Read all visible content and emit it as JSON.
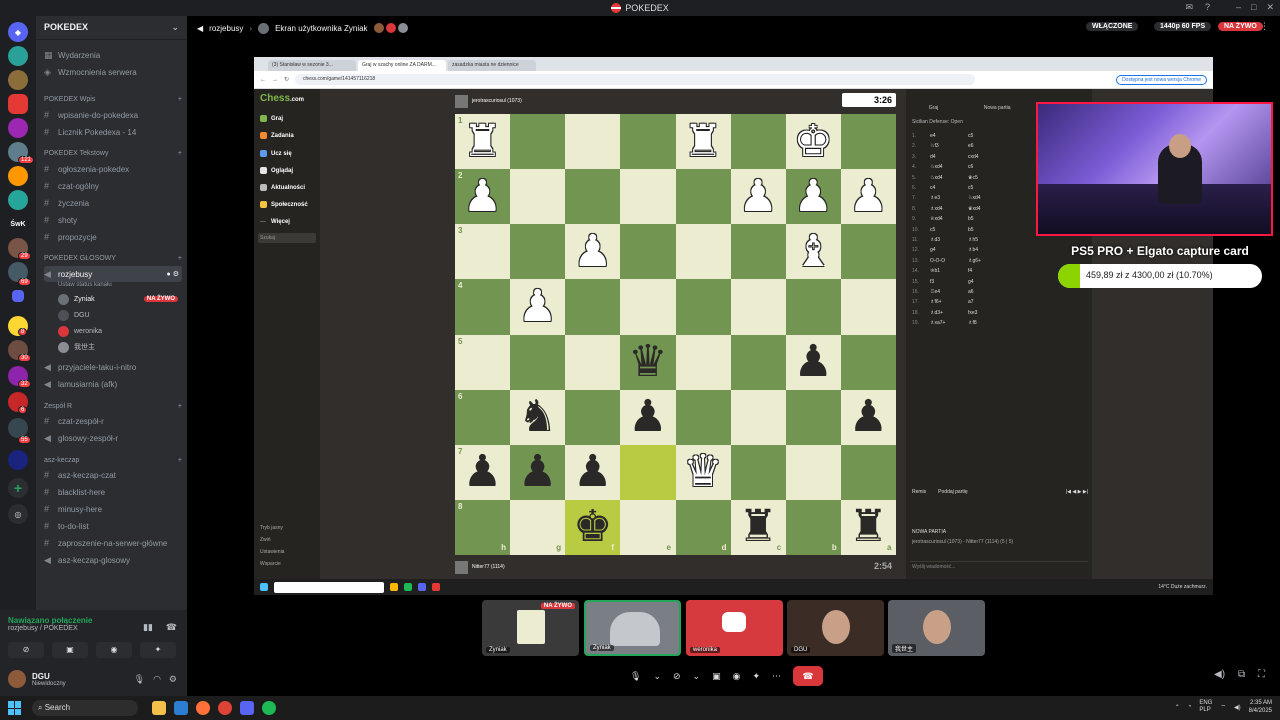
{
  "window": {
    "title": "POKEDEX"
  },
  "sidebar": {
    "server_name": "POKEDEX",
    "top_items": [
      "Wydarzenia",
      "Wzmocnienia serwera"
    ],
    "categories": [
      {
        "name": "POKEDEX Wpis",
        "channels": [
          "wpisanie-do-pokedexa",
          "Licznik Pokedexa - 14"
        ]
      },
      {
        "name": "POKEDEX Tekstowy",
        "channels": [
          "ogłoszenia-pokedex",
          "czat-ogólny",
          "życzenia",
          "shoty",
          "propozycje"
        ]
      },
      {
        "name": "POKEDEX GŁOSOWY",
        "channels": [
          "rozjebusy"
        ]
      },
      {
        "name": "Zespół R",
        "channels": [
          "czat-zespół-r",
          "glosowy-zespół-r"
        ]
      },
      {
        "name": "asz-keczap",
        "channels": [
          "asz-keczap-czat",
          "blacklist-here",
          "minusy-here",
          "to-do-list",
          "zaproszenie-na-serwer-główne",
          "asz-keczap-glosowy"
        ]
      }
    ],
    "voice_status_set": "Ustaw status kanału",
    "voice_users": [
      {
        "name": "Zyniak",
        "live": "NA ŻYWO"
      },
      {
        "name": "DGU",
        "live": ""
      },
      {
        "name": "weronika",
        "live": ""
      },
      {
        "name": "我世主",
        "live": ""
      }
    ],
    "other_channels": [
      "przyjaciele-taku-i-nitro",
      "lamusiarnia (afk)"
    ],
    "server_badges": [
      "29",
      "69",
      "121",
      "8",
      "30",
      "32",
      "6",
      "55"
    ]
  },
  "voice_panel": {
    "status": "Nawiązano połączenie",
    "subtitle": "rozjebusy / POKEDEX"
  },
  "user_panel": {
    "name": "DGU",
    "status": "Niewidoczny"
  },
  "header": {
    "channel": "rozjebusy",
    "stream_label": "Ekran użytkownika Zyniak",
    "enabled": "WŁĄCZONE",
    "quality": "1440p 60 FPS",
    "live": "NA ŻYWO"
  },
  "browser": {
    "url": "chess.com/game/141457116218",
    "update_btn": "Dostępna jest nowa wersja Chrome",
    "tabs": [
      "(3) Stanisław w sezonie 3...",
      "Graj w szachy online ZA DARM...",
      "zasadzka miasta ne dziennice"
    ]
  },
  "chess": {
    "logo_main": "Chess",
    "logo_suffix": ".com",
    "nav": [
      "Graj",
      "Zadania",
      "Ucz się",
      "Oglądaj",
      "Aktualności",
      "Społeczność",
      "Więcej"
    ],
    "search_placeholder": "Szukaj",
    "footer": [
      "Tryb jasny",
      "Zwiń",
      "Ustawienia",
      "Wsparcie"
    ],
    "opponent": "jerotrascuriosul (1073)",
    "player": "Nitter77 (1114)",
    "opp_clock": "3:26",
    "my_clock": "2:54",
    "ranks": [
      "1",
      "2",
      "3",
      "4",
      "5",
      "6",
      "7",
      "8"
    ],
    "files": [
      "h",
      "g",
      "f",
      "e",
      "d",
      "c",
      "b",
      "a"
    ],
    "panel_tabs": [
      "Graj",
      "Nowa partia",
      "Partie"
    ],
    "opening": "Sicilian Defense: Open",
    "moves": [
      [
        "1.",
        "e4",
        "c5"
      ],
      [
        "2.",
        "♘f3",
        "e6"
      ],
      [
        "3.",
        "d4",
        "cxd4"
      ],
      [
        "4.",
        "♘xd4",
        "c6"
      ],
      [
        "5.",
        "♘xd4",
        "♛c5"
      ],
      [
        "6.",
        "c4",
        "c5"
      ],
      [
        "7.",
        "♗e3",
        "♘xd4"
      ],
      [
        "8.",
        "♗xd4",
        "♛xd4"
      ],
      [
        "9.",
        "♕xd4",
        "b5"
      ],
      [
        "10.",
        "c5",
        "b5"
      ],
      [
        "11.",
        "♗d3",
        "♗h5"
      ],
      [
        "12.",
        "g4",
        "♗b4"
      ],
      [
        "13.",
        "O-O-O",
        "♗g6+"
      ],
      [
        "14.",
        "♔b1",
        "f4"
      ],
      [
        "15.",
        "f3",
        "g4"
      ],
      [
        "16.",
        "♖e4",
        "a6"
      ],
      [
        "17.",
        "♗f6+",
        "a7"
      ],
      [
        "18.",
        "♗d3+",
        "fxe3"
      ],
      [
        "19.",
        "♗xa7+",
        "♗f8"
      ]
    ],
    "controls": [
      "Remis",
      "Poddaj partię"
    ],
    "new_game": "NOWA PARTIA",
    "game_summary": "jerotrascuriosul (1073) - Nitter77 (1114) (5 | 5)",
    "chat_placeholder": "Wyślij wiadomość...",
    "weather": "14°C Duże zachmurz."
  },
  "overlay": {
    "title": "PS5 PRO + Elgato capture card",
    "progress_text": "459,89 zł z 4300,00 zł (10.70%)",
    "progress": 0.107
  },
  "participants": [
    {
      "name": "Zyniak",
      "live": "NA ŻYWO",
      "color": "#3a3a3a"
    },
    {
      "name": "Zyniak",
      "live": "",
      "color": "#7a7f86"
    },
    {
      "name": "weronika",
      "live": "",
      "color": "#d63a3f"
    },
    {
      "name": "DGU",
      "live": "",
      "color": "#3b2c26"
    },
    {
      "name": "我世主",
      "live": "",
      "color": "#5b5e64"
    }
  ],
  "taskbar": {
    "search": "Search",
    "lang": "ENG\nPLP",
    "time": "2:35 AM",
    "date": "8/4/2025"
  },
  "colors": {
    "discord_bg": "#2b2d31",
    "rail": "#1e1f22",
    "accent_red": "#da373c",
    "board_light": "#ebecd0",
    "board_dark": "#739552",
    "highlight": "#b9ca43"
  }
}
